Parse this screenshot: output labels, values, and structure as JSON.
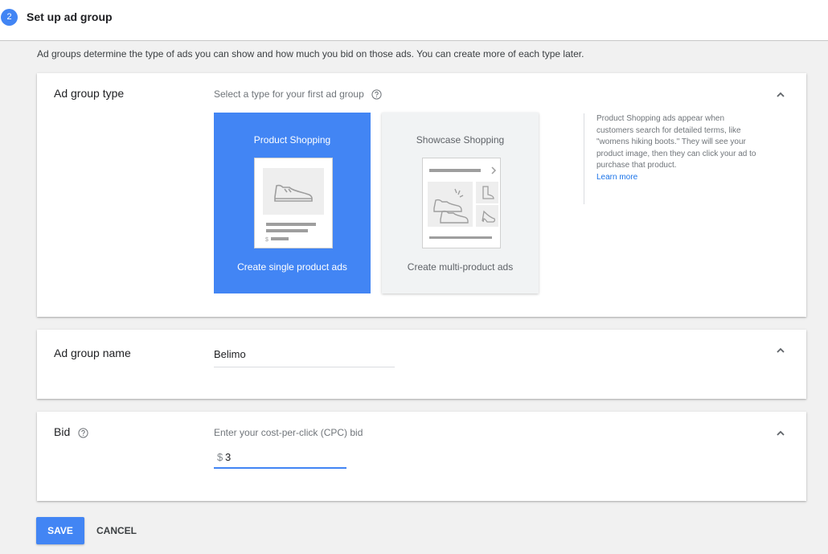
{
  "header": {
    "step_number": "2",
    "title": "Set up ad group"
  },
  "intro_text": "Ad groups determine the type of ads you can show and how much you bid on those ads. You can create more of each type later.",
  "ad_group_type": {
    "label": "Ad group type",
    "hint": "Select a type for your first ad group",
    "options": [
      {
        "title": "Product Shopping",
        "subtitle": "Create single product ads",
        "selected": true
      },
      {
        "title": "Showcase Shopping",
        "subtitle": "Create multi-product ads",
        "selected": false
      }
    ],
    "info_text": "Product Shopping ads appear when customers search for detailed terms, like \"womens hiking boots.\" They will see your product image, then they can click your ad to purchase that product.",
    "info_link": "Learn more"
  },
  "ad_group_name": {
    "label": "Ad group name",
    "value": "Belimo"
  },
  "bid": {
    "label": "Bid",
    "hint": "Enter your cost-per-click (CPC) bid",
    "currency": "$",
    "value": "3"
  },
  "actions": {
    "save_label": "SAVE",
    "cancel_label": "CANCEL"
  },
  "colors": {
    "accent": "#4285f4",
    "link": "#1a73e8",
    "background": "#f1f1f1"
  }
}
